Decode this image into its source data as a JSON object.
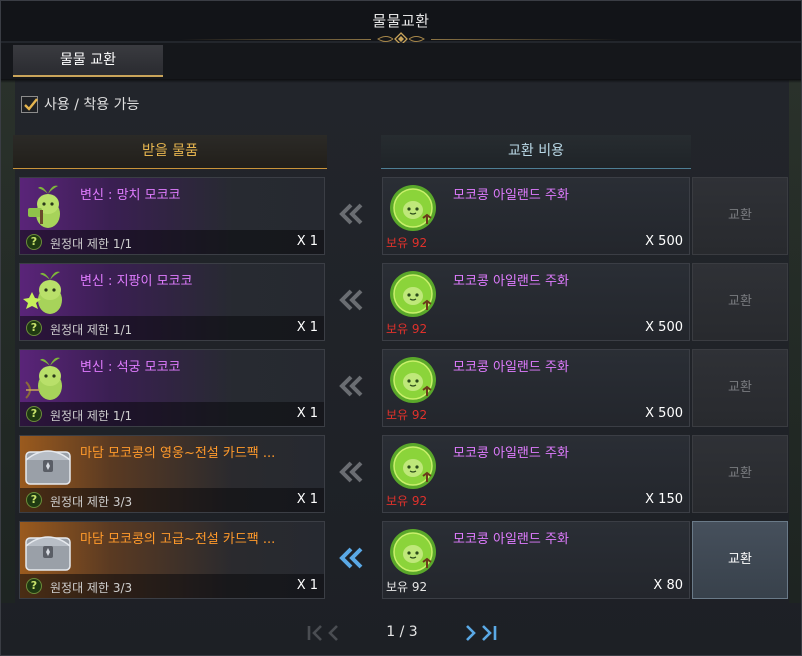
{
  "window": {
    "title": "물물교환"
  },
  "tabs": [
    {
      "label": "물물 교환",
      "active": true
    }
  ],
  "filter": {
    "label": "사용 / 착용 가능",
    "checked": true
  },
  "columns": {
    "receive_header": "받을 물품",
    "cost_header": "교환 비용"
  },
  "rows": [
    {
      "receive": {
        "name": "변신 : 망치 모코코",
        "limit": "원정대 제한 1/1",
        "qty": "X 1",
        "grade": "purple",
        "icon": "mokoko-hammer-icon"
      },
      "cost": {
        "name": "모코콩 아일랜드 주화",
        "owned": "보유 92",
        "qty": "X 500",
        "sufficient": false
      },
      "button": {
        "label": "교환",
        "enabled": false
      }
    },
    {
      "receive": {
        "name": "변신 : 지팡이 모코코",
        "limit": "원정대 제한 1/1",
        "qty": "X 1",
        "grade": "purple",
        "icon": "mokoko-staff-icon"
      },
      "cost": {
        "name": "모코콩 아일랜드 주화",
        "owned": "보유 92",
        "qty": "X 500",
        "sufficient": false
      },
      "button": {
        "label": "교환",
        "enabled": false
      }
    },
    {
      "receive": {
        "name": "변신 : 석궁 모코코",
        "limit": "원정대 제한 1/1",
        "qty": "X 1",
        "grade": "purple",
        "icon": "mokoko-crossbow-icon"
      },
      "cost": {
        "name": "모코콩 아일랜드 주화",
        "owned": "보유 92",
        "qty": "X 500",
        "sufficient": false
      },
      "button": {
        "label": "교환",
        "enabled": false
      }
    },
    {
      "receive": {
        "name": "마담 모코콩의 영웅~전설 카드팩 ...",
        "limit": "원정대 제한 3/3",
        "qty": "X 1",
        "grade": "orange",
        "icon": "card-pack-chest-icon"
      },
      "cost": {
        "name": "모코콩 아일랜드 주화",
        "owned": "보유 92",
        "qty": "X 150",
        "sufficient": false
      },
      "button": {
        "label": "교환",
        "enabled": false
      }
    },
    {
      "receive": {
        "name": "마담 모코콩의 고급~전설 카드팩 ...",
        "limit": "원정대 제한 3/3",
        "qty": "X 1",
        "grade": "orange",
        "icon": "card-pack-chest-icon"
      },
      "cost": {
        "name": "모코콩 아일랜드 주화",
        "owned": "보유 92",
        "qty": "X 80",
        "sufficient": true
      },
      "button": {
        "label": "교환",
        "enabled": true
      }
    }
  ],
  "pagination": {
    "text": "1 / 3",
    "current": 1,
    "total": 3
  },
  "colors": {
    "accent_gold": "#c9a45a",
    "purple_name": "#e07cff",
    "orange_name": "#ff9a2b",
    "insufficient": "#e0312b",
    "arrow_active": "#5aa9e6",
    "arrow_inactive": "#6a6d72"
  }
}
